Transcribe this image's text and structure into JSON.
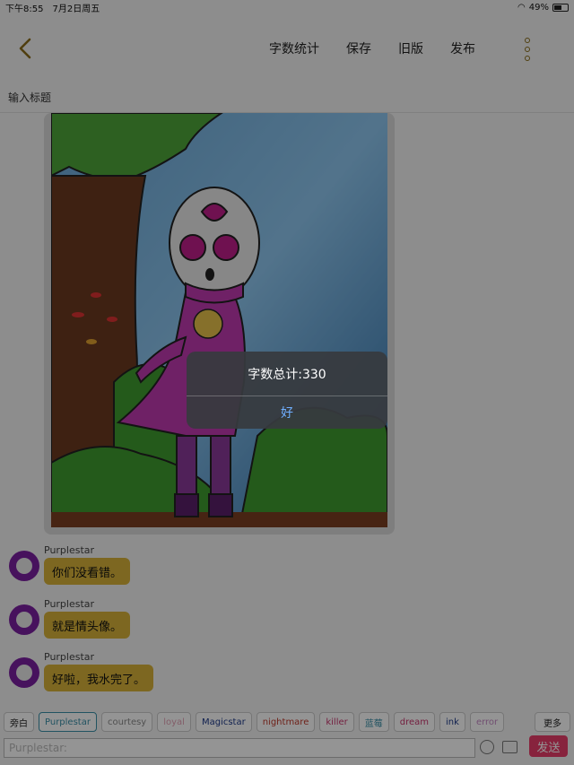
{
  "status": {
    "time": "下午8:55",
    "date": "7月2日周五",
    "battery": "49%"
  },
  "nav": {
    "actions": [
      "字数统计",
      "保存",
      "旧版",
      "发布"
    ]
  },
  "title_input": {
    "placeholder": "输入标题"
  },
  "messages": [
    {
      "sender": "Purplestar",
      "text": "你们没看错。"
    },
    {
      "sender": "Purplestar",
      "text": "就是情头像。"
    },
    {
      "sender": "Purplestar",
      "text": "好啦，我水完了。"
    }
  ],
  "tags": [
    {
      "label": "旁白",
      "color": "#222222"
    },
    {
      "label": "Purplestar",
      "color": "#3a8fa8"
    },
    {
      "label": "courtesy",
      "color": "#8a8a8a"
    },
    {
      "label": "loyal",
      "color": "#e2a2b5"
    },
    {
      "label": "Magicstar",
      "color": "#1e3a8a"
    },
    {
      "label": "nightmare",
      "color": "#c0392b"
    },
    {
      "label": "killer",
      "color": "#c9366e"
    },
    {
      "label": "蓝莓",
      "color": "#3a8fa8"
    },
    {
      "label": "dream",
      "color": "#c9366e"
    },
    {
      "label": "ink",
      "color": "#1e3a8a"
    },
    {
      "label": "error",
      "color": "#c489c4"
    }
  ],
  "more_tags": "更多",
  "composer": {
    "placeholder": "Purplestar:"
  },
  "send_label": "发送",
  "alert": {
    "message": "字数总计:330",
    "ok": "好"
  },
  "colors": {
    "bubble": "#d7b23a",
    "send": "#e83d6a",
    "avatar": "#7a1fa0",
    "accent": "#8a6d1a"
  }
}
